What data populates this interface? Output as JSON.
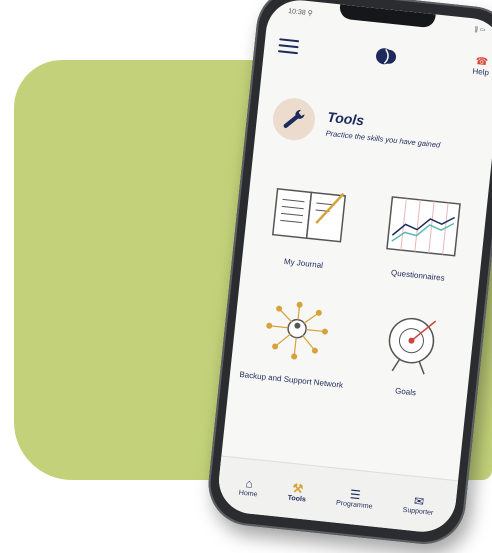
{
  "status_bar": {
    "time": "10:38 ⚲",
    "battery": "⫼ ▭"
  },
  "topbar": {
    "help_label": "Help"
  },
  "header": {
    "title": "Tools",
    "subtitle": "Practice the skills you have gained"
  },
  "tiles": [
    {
      "label": "My Journal"
    },
    {
      "label": "Questionnaires"
    },
    {
      "label": "Backup and Support Network"
    },
    {
      "label": "Goals"
    }
  ],
  "bottom_nav": [
    {
      "label": "Home",
      "icon": "home-icon"
    },
    {
      "label": "Tools",
      "icon": "wrench-icon"
    },
    {
      "label": "Programme",
      "icon": "list-icon"
    },
    {
      "label": "Supporter",
      "icon": "mail-icon"
    }
  ],
  "colors": {
    "brand_navy": "#1d2a5c",
    "green_bg": "#c3d27a",
    "accent_gold": "#d6a33a"
  }
}
